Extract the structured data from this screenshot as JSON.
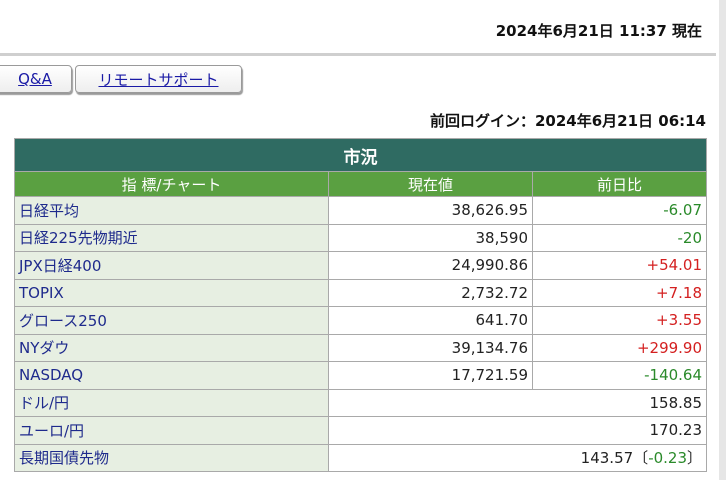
{
  "header": {
    "datetime": "2024年6月21日 11:37 現在",
    "last_login": "前回ログイン：2024年6月21日 06:14"
  },
  "nav": {
    "qa_label": "Q&A",
    "remote_support_label": "リモートサポート"
  },
  "market": {
    "title": "市況",
    "columns": [
      "指 標/チャート",
      "現在値",
      "前日比"
    ],
    "rows": [
      {
        "name": "日経平均",
        "value": "38,626.95",
        "change": "-6.07"
      },
      {
        "name": "日経225先物期近",
        "value": "38,590",
        "change": "-20"
      },
      {
        "name": "JPX日経400",
        "value": "24,990.86",
        "change": "+54.01"
      },
      {
        "name": "TOPIX",
        "value": "2,732.72",
        "change": "+7.18"
      },
      {
        "name": "グロース250",
        "value": "641.70",
        "change": "+3.55"
      },
      {
        "name": "NYダウ",
        "value": "39,134.76",
        "change": "+299.90"
      },
      {
        "name": "NASDAQ",
        "value": "17,721.59",
        "change": "-140.64"
      }
    ],
    "fx_rows": [
      {
        "name": "ドル/円",
        "value": "158.85"
      },
      {
        "name": "ユーロ/円",
        "value": "170.23"
      }
    ],
    "bond_row": {
      "name": "長期国債先物",
      "value": "143.57",
      "change_prefix": "〔",
      "change": "-0.23",
      "change_suffix": "〕"
    }
  },
  "colors": {
    "caption_bg": "#2f6b62",
    "header_bg": "#5aa041",
    "name_bg": "#e7efe2",
    "positive": "#d42020",
    "negative": "#2a8a2a"
  }
}
